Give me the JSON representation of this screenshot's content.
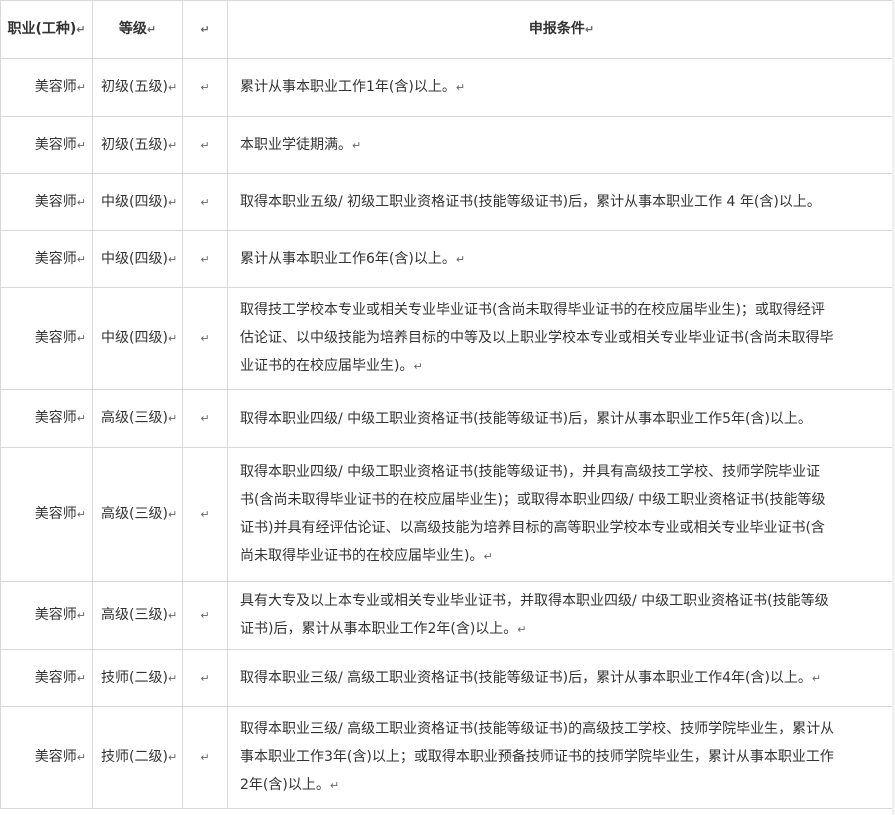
{
  "table": {
    "headers": {
      "job": "职业(工种)",
      "level": "等级",
      "blank": "",
      "condition": "申报条件"
    },
    "paragraph_mark": "↵",
    "rows": [
      {
        "job": "美容师",
        "level": "初级(五级)",
        "condition": "累计从事本职业工作1年(含)以上。"
      },
      {
        "job": "美容师",
        "level": "初级(五级)",
        "condition": "本职业学徒期满。"
      },
      {
        "job": "美容师",
        "level": "中级(四级)",
        "condition": "取得本职业五级/ 初级工职业资格证书(技能等级证书)后，累计从事本职业工作 4 年(含)以上。"
      },
      {
        "job": "美容师",
        "level": "中级(四级)",
        "condition": "累计从事本职业工作6年(含)以上。"
      },
      {
        "job": "美容师",
        "level": "中级(四级)",
        "condition": "取得技工学校本专业或相关专业毕业证书(含尚未取得毕业证书的在校应届毕业生)；或取得经评\n估论证、以中级技能为培养目标的中等及以上职业学校本专业或相关专业毕业证书(含尚未取得毕\n业证书的在校应届毕业生)。"
      },
      {
        "job": "美容师",
        "level": "高级(三级)",
        "condition": "取得本职业四级/ 中级工职业资格证书(技能等级证书)后，累计从事本职业工作5年(含)以上。"
      },
      {
        "job": "美容师",
        "level": "高级(三级)",
        "condition": "取得本职业四级/ 中级工职业资格证书(技能等级证书)，并具有高级技工学校、技师学院毕业证\n书(含尚未取得毕业证书的在校应届毕业生)；或取得本职业四级/ 中级工职业资格证书(技能等级\n证书)并具有经评估论证、以高级技能为培养目标的高等职业学校本专业或相关专业毕业证书(含\n尚未取得毕业证书的在校应届毕业生)。"
      },
      {
        "job": "美容师",
        "level": "高级(三级)",
        "condition": "具有大专及以上本专业或相关专业毕业证书，并取得本职业四级/ 中级工职业资格证书(技能等级\n证书)后，累计从事本职业工作2年(含)以上。"
      },
      {
        "job": "美容师",
        "level": "技师(二级)",
        "condition": "取得本职业三级/ 高级工职业资格证书(技能等级证书)后，累计从事本职业工作4年(含)以上。"
      },
      {
        "job": "美容师",
        "level": "技师(二级)",
        "condition": "取得本职业三级/ 高级工职业资格证书(技能等级证书)的高级技工学校、技师学院毕业生，累计从\n事本职业工作3年(含)以上；或取得本职业预备技师证书的技师学院毕业生，累计从事本职业工作\n2年(含)以上。"
      }
    ]
  }
}
